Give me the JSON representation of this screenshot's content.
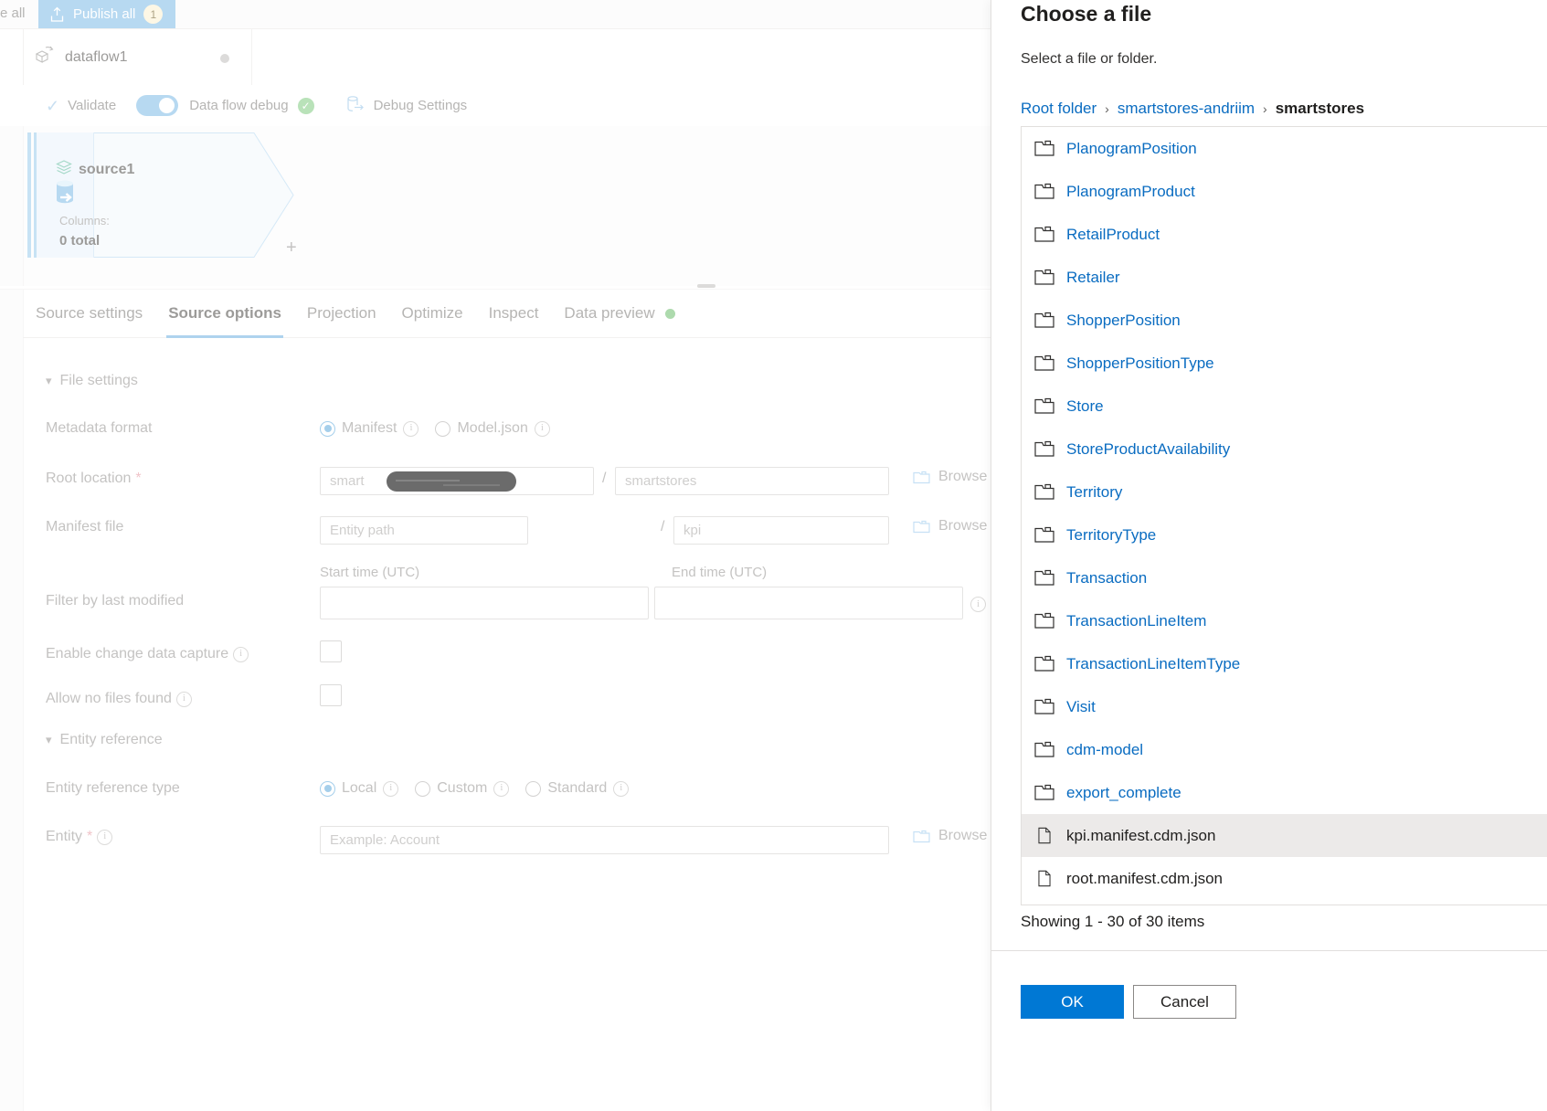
{
  "commandbar": {
    "left_truncated_label": "e all",
    "publish_label": "Publish all",
    "publish_count": "1",
    "publish_icon": "upload-icon"
  },
  "dataflow_tab": {
    "name": "dataflow1",
    "icon": "dataflow-icon",
    "dirty_indicator": "unsaved-dot"
  },
  "toolbar": {
    "validate_label": "Validate",
    "validate_icon": "checkmark-icon",
    "debug_toggle_label": "Data flow debug",
    "debug_toggle_state": "on",
    "debug_status_icon": "success-check-icon",
    "debug_settings_label": "Debug Settings",
    "debug_settings_icon": "database-export-icon"
  },
  "canvas": {
    "node": {
      "title": "source1",
      "title_icon": "source-dataset-icon",
      "type_icon": "adls-source-icon",
      "columns_label": "Columns:",
      "columns_value": "0 total",
      "add_icon": "plus-icon"
    }
  },
  "pane": {
    "tabs": [
      {
        "label": "Source settings",
        "active": false
      },
      {
        "label": "Source options",
        "active": true
      },
      {
        "label": "Projection",
        "active": false
      },
      {
        "label": "Optimize",
        "active": false
      },
      {
        "label": "Inspect",
        "active": false
      },
      {
        "label": "Data preview",
        "active": false,
        "status_dot": "green"
      }
    ]
  },
  "form": {
    "file_settings": {
      "section_label": "File settings",
      "expanded": true,
      "metadata_format": {
        "label": "Metadata format",
        "options": [
          {
            "label": "Manifest",
            "selected": true,
            "info": "info-icon"
          },
          {
            "label": "Model.json",
            "selected": false,
            "info": "info-icon"
          }
        ]
      },
      "root_location": {
        "label": "Root location",
        "required": true,
        "container_value": "smart",
        "container_redacted": true,
        "separator": "/",
        "folder_value": "smartstores",
        "browse_label": "Browse",
        "browse_icon": "folder-icon"
      },
      "manifest_file": {
        "label": "Manifest file",
        "entity_path_placeholder": "Entity path",
        "separator": "/",
        "manifest_name_value": "kpi",
        "browse_label": "Browse",
        "browse_icon": "folder-icon"
      },
      "filter_by_last_modified": {
        "label": "Filter by last modified",
        "start_label": "Start time (UTC)",
        "start_value": "",
        "end_label": "End time (UTC)",
        "end_value": "",
        "info": "info-icon"
      },
      "enable_cdc": {
        "label": "Enable change data capture",
        "info": "info-icon",
        "checked": false
      },
      "allow_no_files": {
        "label": "Allow no files found",
        "info": "info-icon",
        "checked": false
      }
    },
    "entity_reference": {
      "section_label": "Entity reference",
      "expanded": true,
      "entity_reference_type": {
        "label": "Entity reference type",
        "options": [
          {
            "label": "Local",
            "selected": true,
            "info": "info-icon"
          },
          {
            "label": "Custom",
            "selected": false,
            "info": "info-icon"
          },
          {
            "label": "Standard",
            "selected": false,
            "info": "info-icon"
          }
        ]
      },
      "entity": {
        "label": "Entity",
        "required": true,
        "info": "info-icon",
        "placeholder": "Example: Account",
        "value": "",
        "browse_label": "Browse",
        "browse_icon": "folder-icon"
      }
    }
  },
  "panel": {
    "title": "Choose a file",
    "subtitle": "Select a file or folder.",
    "breadcrumb": [
      {
        "label": "Root folder",
        "current": false
      },
      {
        "label": "smartstores-andriim",
        "current": false
      },
      {
        "label": "smartstores",
        "current": true
      }
    ],
    "breadcrumb_separator": "›",
    "items": [
      {
        "name": "PlanogramPosition",
        "kind": "folder",
        "selected": false
      },
      {
        "name": "PlanogramProduct",
        "kind": "folder",
        "selected": false
      },
      {
        "name": "RetailProduct",
        "kind": "folder",
        "selected": false
      },
      {
        "name": "Retailer",
        "kind": "folder",
        "selected": false
      },
      {
        "name": "ShopperPosition",
        "kind": "folder",
        "selected": false
      },
      {
        "name": "ShopperPositionType",
        "kind": "folder",
        "selected": false
      },
      {
        "name": "Store",
        "kind": "folder",
        "selected": false
      },
      {
        "name": "StoreProductAvailability",
        "kind": "folder",
        "selected": false
      },
      {
        "name": "Territory",
        "kind": "folder",
        "selected": false
      },
      {
        "name": "TerritoryType",
        "kind": "folder",
        "selected": false
      },
      {
        "name": "Transaction",
        "kind": "folder",
        "selected": false
      },
      {
        "name": "TransactionLineItem",
        "kind": "folder",
        "selected": false
      },
      {
        "name": "TransactionLineItemType",
        "kind": "folder",
        "selected": false
      },
      {
        "name": "Visit",
        "kind": "folder",
        "selected": false
      },
      {
        "name": "cdm-model",
        "kind": "folder",
        "selected": false
      },
      {
        "name": "export_complete",
        "kind": "folder",
        "selected": false
      },
      {
        "name": "kpi.manifest.cdm.json",
        "kind": "file",
        "selected": true
      },
      {
        "name": "root.manifest.cdm.json",
        "kind": "file",
        "selected": false
      }
    ],
    "showing_text": "Showing 1 - 30 of 30 items",
    "ok_label": "OK",
    "cancel_label": "Cancel"
  },
  "colors": {
    "accent": "#0078d4",
    "link": "#0a6cc1",
    "publish_button": "#8cc3ea",
    "success": "#7cc47c",
    "selected_row": "#eceae9"
  }
}
